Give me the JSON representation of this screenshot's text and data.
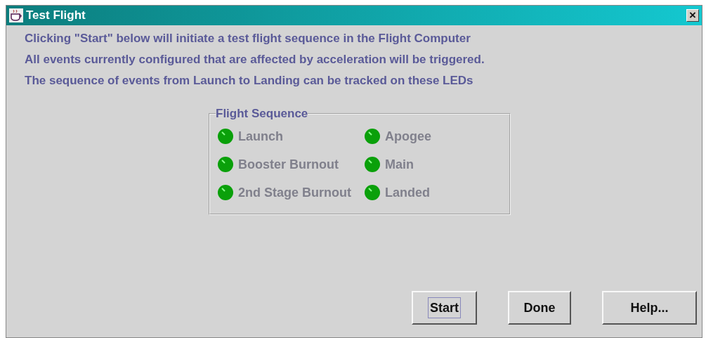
{
  "window": {
    "title": "Test Flight",
    "close": "×"
  },
  "message": [
    "Clicking \"Start\" below will initiate a test flight sequence in the Flight Computer",
    "All events currently configured that are affected by acceleration will be triggered.",
    "The sequence of events from Launch to Landing can be tracked on these LEDs"
  ],
  "flight_sequence": {
    "title": "Flight Sequence",
    "columns": [
      [
        {
          "label": "Launch",
          "disabled": true,
          "color": "#0aa00a"
        },
        {
          "label": "Booster Burnout",
          "disabled": true,
          "color": "#0aa00a"
        },
        {
          "label": "2nd Stage Burnout",
          "disabled": true,
          "color": "#0aa00a"
        }
      ],
      [
        {
          "label": "Apogee",
          "disabled": true,
          "color": "#0aa00a"
        },
        {
          "label": "Main",
          "disabled": true,
          "color": "#0aa00a"
        },
        {
          "label": "Landed",
          "disabled": true,
          "color": "#0aa00a"
        }
      ]
    ]
  },
  "buttons": [
    {
      "label": "Start",
      "focused": true
    },
    {
      "label": "Done",
      "focused": false
    },
    {
      "label": "Help...",
      "focused": false
    }
  ]
}
